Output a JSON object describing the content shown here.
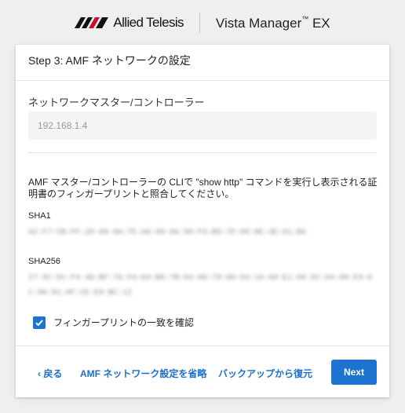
{
  "brand": {
    "logo_text": "Allied Telesis",
    "product_name": "Vista Manager",
    "product_tm": "™",
    "product_suffix": " EX"
  },
  "step": {
    "title": "Step 3: AMF ネットワークの設定"
  },
  "network_master": {
    "label": "ネットワークマスター/コントローラー",
    "value": "192.168.1.4"
  },
  "instruction": "AMF マスター/コントローラーの CLIで \"show http\" コマンドを実行し表示される証明書のフィンガープリントと照合してください。",
  "fingerprints": {
    "sha1_label": "SHA1",
    "sha1_value": "A2:F7:CB:FF:2D:68:9A:7E:A6:99:86:98:F6:B5:7E:06:8E:3E:91:B6",
    "sha256_label": "SHA256",
    "sha256_value": "27:5C:DC:F4:4D:BF:76:FA:E6:B8:7B:04:86:79:DD:64:16:A0:E1:06:5C:04:00:E3:6C:96:01:0F:CE:E0:BC:12"
  },
  "confirm": {
    "label": "フィンガープリントの一致を確認",
    "checked": true
  },
  "footer": {
    "back_label": "戻る",
    "skip_label": "AMF ネットワーク設定を省略",
    "restore_label": "バックアップから復元",
    "next_label": "Next"
  },
  "colors": {
    "accent": "#1e73cf",
    "link": "#1d6fc7",
    "background": "#efefef",
    "card": "#ffffff"
  }
}
